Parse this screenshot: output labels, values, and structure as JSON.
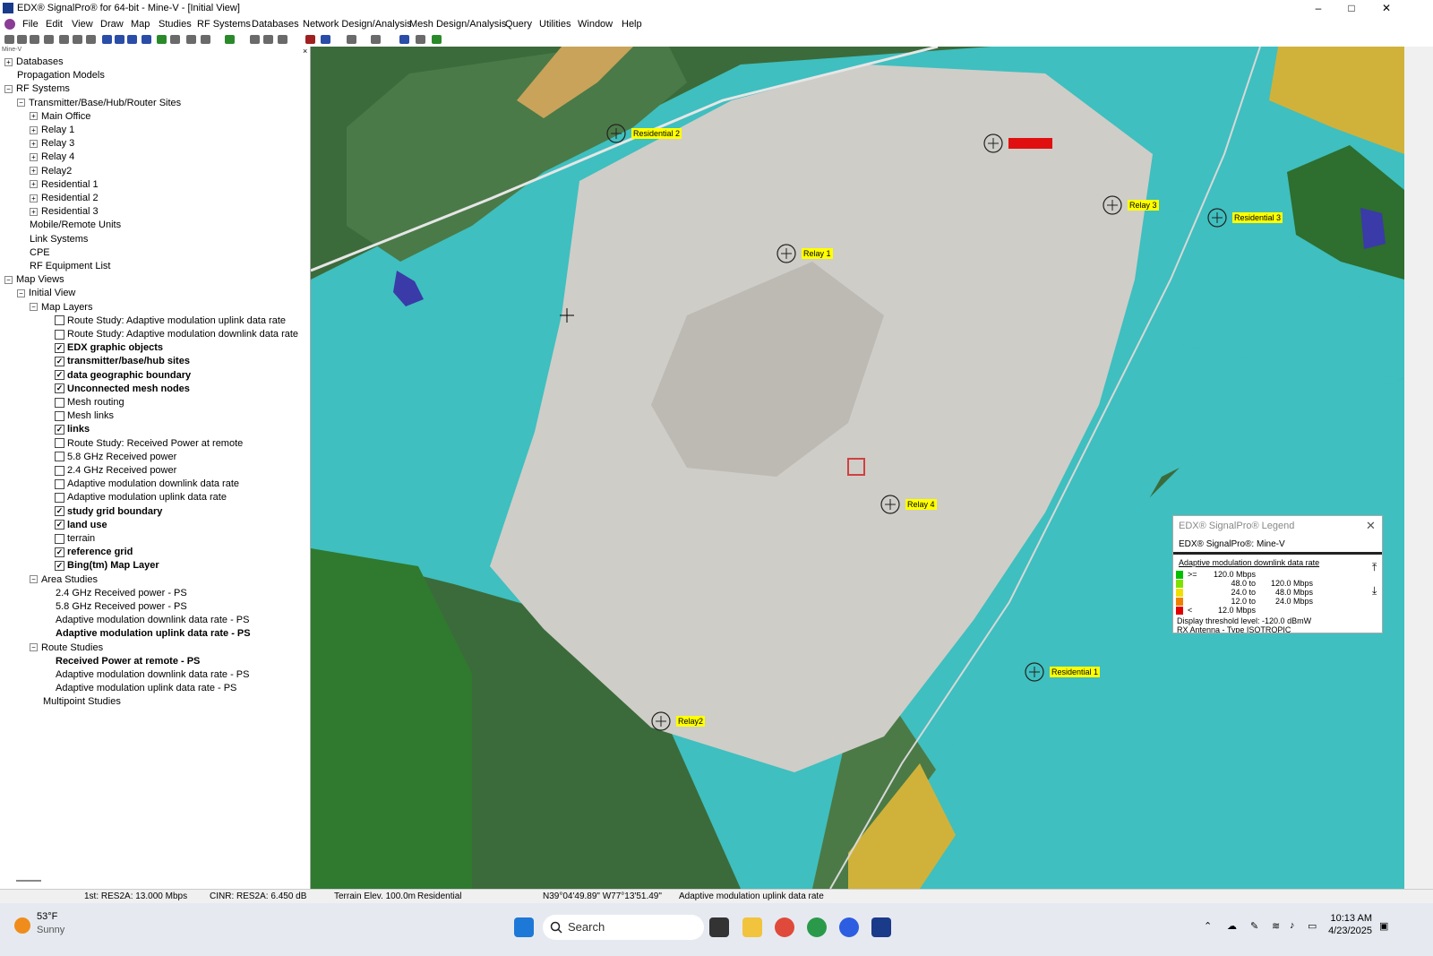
{
  "window": {
    "title": "EDX® SignalPro®  for 64-bit - Mine-V - [Initial View]",
    "controls": {
      "minimize": "–",
      "maximize": "□",
      "close": "✕"
    }
  },
  "menu": [
    "File",
    "Edit",
    "View",
    "Draw",
    "Map",
    "Studies",
    "RF Systems",
    "Databases",
    "Network Design/Analysis",
    "Mesh Design/Analysis",
    "Query",
    "Utilities",
    "Window",
    "Help"
  ],
  "tree_pane": {
    "title": "Mine-V",
    "close": "×",
    "items": [
      {
        "label": "Databases",
        "exp": "+",
        "chk": null,
        "bold": false
      },
      {
        "label": "Propagation Models",
        "exp": null,
        "chk": null,
        "bold": false
      },
      {
        "label": "RF Systems",
        "exp": "−",
        "chk": null,
        "bold": false
      },
      {
        "label": "Transmitter/Base/Hub/Router Sites",
        "exp": "−",
        "chk": null,
        "bold": false
      },
      {
        "label": "Main Office",
        "exp": "+",
        "chk": null,
        "bold": false
      },
      {
        "label": "Relay 1",
        "exp": "+",
        "chk": null,
        "bold": false
      },
      {
        "label": "Relay 3",
        "exp": "+",
        "chk": null,
        "bold": false
      },
      {
        "label": "Relay 4",
        "exp": "+",
        "chk": null,
        "bold": false
      },
      {
        "label": "Relay2",
        "exp": "+",
        "chk": null,
        "bold": false
      },
      {
        "label": "Residential 1",
        "exp": "+",
        "chk": null,
        "bold": false
      },
      {
        "label": "Residential 2",
        "exp": "+",
        "chk": null,
        "bold": false
      },
      {
        "label": "Residential 3",
        "exp": "+",
        "chk": null,
        "bold": false
      },
      {
        "label": "Mobile/Remote Units",
        "exp": null,
        "chk": null,
        "bold": false
      },
      {
        "label": "Link Systems",
        "exp": null,
        "chk": null,
        "bold": false
      },
      {
        "label": "CPE",
        "exp": null,
        "chk": null,
        "bold": false
      },
      {
        "label": "RF Equipment List",
        "exp": null,
        "chk": null,
        "bold": false
      },
      {
        "label": "Map Views",
        "exp": "−",
        "chk": null,
        "bold": false
      },
      {
        "label": "Initial View",
        "exp": "−",
        "chk": null,
        "bold": false
      },
      {
        "label": "Map Layers",
        "exp": "−",
        "chk": null,
        "bold": false
      },
      {
        "label": "Route Study: Adaptive modulation uplink data rate",
        "exp": null,
        "chk": false,
        "bold": false
      },
      {
        "label": "Route Study: Adaptive modulation downlink data rate",
        "exp": null,
        "chk": false,
        "bold": false
      },
      {
        "label": "EDX graphic objects",
        "exp": null,
        "chk": true,
        "bold": true
      },
      {
        "label": "transmitter/base/hub sites",
        "exp": null,
        "chk": true,
        "bold": true
      },
      {
        "label": "data geographic boundary",
        "exp": null,
        "chk": true,
        "bold": true
      },
      {
        "label": "Unconnected mesh nodes",
        "exp": null,
        "chk": true,
        "bold": true
      },
      {
        "label": "Mesh routing",
        "exp": null,
        "chk": false,
        "bold": false
      },
      {
        "label": "Mesh links",
        "exp": null,
        "chk": false,
        "bold": false
      },
      {
        "label": "links",
        "exp": null,
        "chk": true,
        "bold": true
      },
      {
        "label": "Route Study: Received Power at remote",
        "exp": null,
        "chk": false,
        "bold": false
      },
      {
        "label": "5.8 GHz Received power",
        "exp": null,
        "chk": false,
        "bold": false
      },
      {
        "label": "2.4 GHz Received power",
        "exp": null,
        "chk": false,
        "bold": false
      },
      {
        "label": "Adaptive modulation downlink data rate",
        "exp": null,
        "chk": false,
        "bold": false
      },
      {
        "label": "Adaptive modulation uplink data rate",
        "exp": null,
        "chk": false,
        "bold": false
      },
      {
        "label": "study grid boundary",
        "exp": null,
        "chk": true,
        "bold": true
      },
      {
        "label": "land use",
        "exp": null,
        "chk": true,
        "bold": true
      },
      {
        "label": "terrain",
        "exp": null,
        "chk": false,
        "bold": false
      },
      {
        "label": "reference grid",
        "exp": null,
        "chk": true,
        "bold": true
      },
      {
        "label": "Bing(tm) Map Layer",
        "exp": null,
        "chk": true,
        "bold": true
      },
      {
        "label": "Area Studies",
        "exp": "−",
        "chk": null,
        "bold": false
      },
      {
        "label": "2.4 GHz Received power - PS",
        "exp": null,
        "chk": null,
        "bold": false
      },
      {
        "label": "5.8 GHz Received power - PS",
        "exp": null,
        "chk": null,
        "bold": false
      },
      {
        "label": "Adaptive modulation downlink data rate - PS",
        "exp": null,
        "chk": null,
        "bold": false
      },
      {
        "label": "Adaptive modulation uplink data rate - PS",
        "exp": null,
        "chk": null,
        "bold": true
      },
      {
        "label": "Route Studies",
        "exp": "−",
        "chk": null,
        "bold": false
      },
      {
        "label": "Received Power at remote - PS",
        "exp": null,
        "chk": null,
        "bold": true
      },
      {
        "label": "Adaptive modulation downlink data rate - PS",
        "exp": null,
        "chk": null,
        "bold": false
      },
      {
        "label": "Adaptive modulation uplink data rate - PS",
        "exp": null,
        "chk": null,
        "bold": false
      },
      {
        "label": "Multipoint Studies",
        "exp": null,
        "chk": null,
        "bold": false
      }
    ]
  },
  "map": {
    "sites": [
      {
        "label": "Residential 2",
        "style": "yellow"
      },
      {
        "label": "Main Office",
        "style": "red"
      },
      {
        "label": "Relay 3",
        "style": "yellow"
      },
      {
        "label": "Residential 3",
        "style": "yellow"
      },
      {
        "label": "Relay 1",
        "style": "yellow"
      },
      {
        "label": "Relay 4",
        "style": "yellow"
      },
      {
        "label": "Residential 1",
        "style": "yellow"
      },
      {
        "label": "Relay2",
        "style": "yellow"
      }
    ],
    "colors": {
      "coverage": "#3fbfbf",
      "forest": "#3b6b3b",
      "quarry": "#cfcdc8",
      "moderate": "#d0b23a",
      "low": "#c8742e"
    }
  },
  "legend": {
    "title": "EDX® SignalPro® Legend",
    "close": "✕",
    "subtitle": "EDX® SignalPro®: Mine-V",
    "heading": "Adaptive modulation downlink data rate",
    "rows": [
      {
        "color": "#00c000",
        "op": ">=",
        "from": "120.0 Mbps",
        "to": ""
      },
      {
        "color": "#80e000",
        "op": "",
        "from": "48.0 to",
        "to": "120.0 Mbps"
      },
      {
        "color": "#f0e000",
        "op": "",
        "from": "24.0 to",
        "to": "48.0 Mbps"
      },
      {
        "color": "#f08000",
        "op": "",
        "from": "12.0 to",
        "to": "24.0 Mbps"
      },
      {
        "color": "#e00000",
        "op": "<",
        "from": "12.0 Mbps",
        "to": ""
      }
    ],
    "threshold": "Display threshold level: -120.0 dBmW",
    "antenna": "RX Antenna - Type ISOTROPIC",
    "scroll_up": "⤒",
    "scroll_down": "⤓"
  },
  "status": {
    "s1": "1st: RES2A: 13.000 Mbps",
    "s2": "CINR: RES2A: 6.450 dB",
    "s3": "Terrain Elev. 100.0m",
    "s4": "Residential",
    "s5": "N39°04'49.89\" W77°13'51.49\"",
    "s6": "Adaptive modulation uplink data rate"
  },
  "taskbar": {
    "weather_temp": "53°F",
    "weather_desc": "Sunny",
    "search": "Search",
    "time": "10:13 AM",
    "date": "4/23/2025"
  }
}
